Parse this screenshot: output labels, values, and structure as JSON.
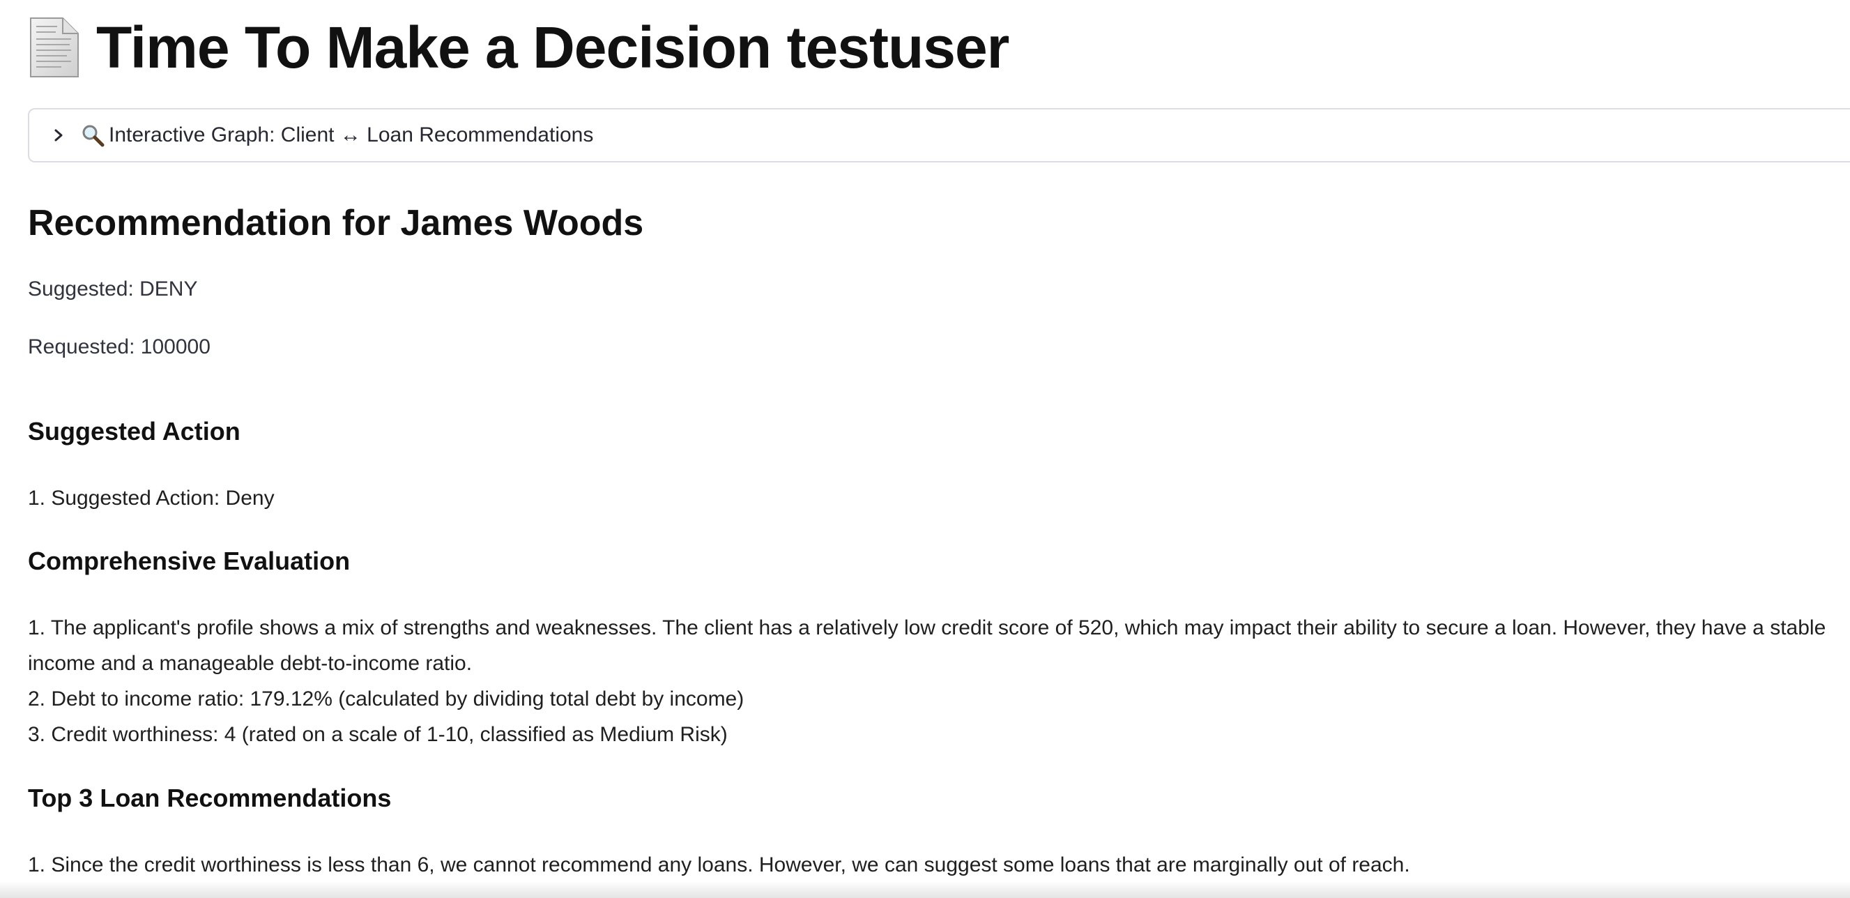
{
  "header": {
    "title": "Time To Make a Decision testuser",
    "icon": "document-icon"
  },
  "expander": {
    "icon": "magnifier-icon",
    "label": "Interactive Graph: Client ↔ Loan Recommendations"
  },
  "recommendation": {
    "title": "Recommendation for James Woods",
    "suggested": "Suggested: DENY",
    "requested": "Requested: 100000"
  },
  "sections": {
    "suggested_action": {
      "heading": "Suggested Action",
      "items": [
        "1. Suggested Action: Deny"
      ]
    },
    "evaluation": {
      "heading": "Comprehensive Evaluation",
      "items": [
        "1. The applicant's profile shows a mix of strengths and weaknesses. The client has a relatively low credit score of 520, which may impact their ability to secure a loan. However, they have a stable",
        "income and a manageable debt-to-income ratio.",
        "2. Debt to income ratio: 179.12% (calculated by dividing total debt by income)",
        "3. Credit worthiness: 4 (rated on a scale of 1-10, classified as Medium Risk)"
      ]
    },
    "loans": {
      "heading": "Top 3 Loan Recommendations",
      "items": [
        "1. Since the credit worthiness is less than 6, we cannot recommend any loans. However, we can suggest some loans that are marginally out of reach."
      ]
    }
  }
}
